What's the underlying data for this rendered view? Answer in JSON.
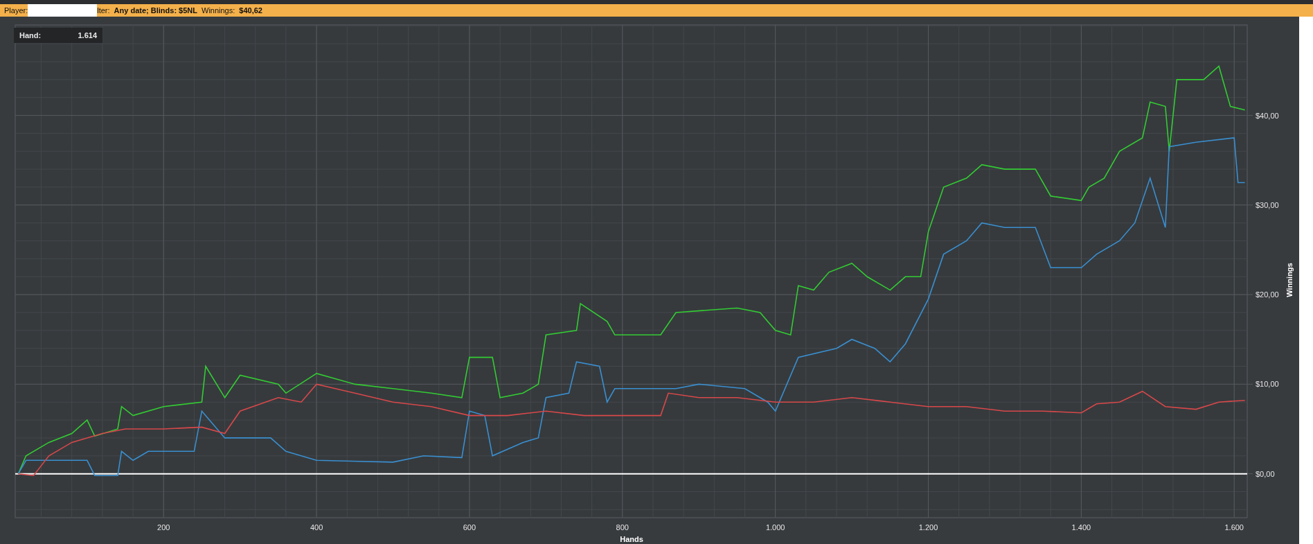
{
  "title_bar": {
    "player_label": "Player:",
    "filter_label": "lter:",
    "filter_value": "Any date; Blinds: $5NL",
    "winnings_label": "Winnings:",
    "winnings_value": "$40,62"
  },
  "chart": {
    "hover_label": "Hand:",
    "hover_value": "1.614",
    "chart_data": {
      "type": "line",
      "grid": true,
      "xlabel": "Hands",
      "ylabel": "Winnings",
      "xlim": [
        6,
        1617
      ],
      "ylim": [
        -4.9,
        50.1
      ],
      "xticks": [
        {
          "value": 200,
          "label": "200"
        },
        {
          "value": 400,
          "label": "400"
        },
        {
          "value": 600,
          "label": "600"
        },
        {
          "value": 800,
          "label": "800"
        },
        {
          "value": 1000,
          "label": "1.000"
        },
        {
          "value": 1200,
          "label": "1.200"
        },
        {
          "value": 1400,
          "label": "1.400"
        },
        {
          "value": 1600,
          "label": "1.600"
        }
      ],
      "yticks": [
        {
          "value": 0,
          "label": "$0,00"
        },
        {
          "value": 10,
          "label": "$10,00"
        },
        {
          "value": 20,
          "label": "$20,00"
        },
        {
          "value": 30,
          "label": "$30,00"
        },
        {
          "value": 40,
          "label": "$40,00"
        }
      ],
      "series": [
        {
          "color": "#33cc33",
          "x": [
            10,
            20,
            50,
            80,
            100,
            110,
            140,
            145,
            160,
            200,
            250,
            255,
            280,
            300,
            350,
            360,
            400,
            450,
            500,
            550,
            590,
            600,
            630,
            640,
            670,
            690,
            700,
            740,
            745,
            780,
            790,
            850,
            870,
            950,
            980,
            1000,
            1020,
            1030,
            1050,
            1070,
            1100,
            1120,
            1150,
            1170,
            1190,
            1200,
            1220,
            1250,
            1270,
            1300,
            1340,
            1360,
            1400,
            1410,
            1430,
            1450,
            1480,
            1490,
            1510,
            1515,
            1525,
            1560,
            1580,
            1595,
            1614
          ],
          "values": [
            0,
            2,
            3.5,
            4.5,
            6,
            4.2,
            5,
            7.5,
            6.5,
            7.5,
            8,
            12,
            8.5,
            11,
            10,
            9,
            11.2,
            10,
            9.5,
            9,
            8.5,
            13,
            13,
            8.5,
            9,
            10,
            15.5,
            16,
            19,
            17,
            15.5,
            15.5,
            18,
            18.5,
            18,
            16,
            15.5,
            21,
            20.5,
            22.5,
            23.5,
            22,
            20.5,
            22,
            22,
            27,
            32,
            33,
            34.5,
            34,
            34,
            31,
            30.5,
            32,
            33,
            36,
            37.5,
            41.5,
            41,
            36,
            44,
            44,
            45.5,
            41,
            40.6
          ]
        },
        {
          "color": "#3a8fd0",
          "x": [
            10,
            20,
            100,
            110,
            140,
            145,
            160,
            180,
            240,
            250,
            280,
            340,
            360,
            400,
            500,
            540,
            590,
            600,
            620,
            630,
            670,
            690,
            700,
            730,
            740,
            770,
            780,
            790,
            870,
            900,
            960,
            990,
            1000,
            1030,
            1080,
            1100,
            1130,
            1150,
            1170,
            1200,
            1220,
            1250,
            1270,
            1300,
            1340,
            1360,
            1400,
            1420,
            1450,
            1470,
            1490,
            1510,
            1515,
            1550,
            1600,
            1605,
            1614
          ],
          "values": [
            0,
            1.5,
            1.5,
            -0.2,
            -0.2,
            2.5,
            1.5,
            2.5,
            2.5,
            7,
            4,
            4,
            2.5,
            1.5,
            1.3,
            2,
            1.8,
            7,
            6.5,
            2,
            3.5,
            4,
            8.5,
            9,
            12.5,
            12,
            8,
            9.5,
            9.5,
            10,
            9.5,
            8,
            7,
            13,
            14,
            15,
            14,
            12.5,
            14.5,
            19.5,
            24.5,
            26,
            28,
            27.5,
            27.5,
            23,
            23,
            24.5,
            26,
            28,
            33,
            27.5,
            36.5,
            37,
            37.5,
            32.5,
            32.5
          ]
        },
        {
          "color": "#d9484a",
          "x": [
            10,
            30,
            50,
            80,
            120,
            150,
            200,
            250,
            280,
            300,
            350,
            380,
            400,
            450,
            500,
            550,
            600,
            650,
            700,
            750,
            800,
            850,
            860,
            900,
            950,
            1000,
            1050,
            1100,
            1150,
            1200,
            1250,
            1300,
            1350,
            1400,
            1420,
            1450,
            1480,
            1510,
            1550,
            1580,
            1614
          ],
          "values": [
            0,
            -0.2,
            2,
            3.5,
            4.5,
            5,
            5,
            5.2,
            4.5,
            7,
            8.5,
            8,
            10,
            9,
            8,
            7.5,
            6.5,
            6.5,
            7,
            6.5,
            6.5,
            6.5,
            9,
            8.5,
            8.5,
            8,
            8,
            8.5,
            8,
            7.5,
            7.5,
            7,
            7,
            6.8,
            7.8,
            8,
            9.2,
            7.5,
            7.2,
            8,
            8.2
          ]
        }
      ]
    }
  }
}
